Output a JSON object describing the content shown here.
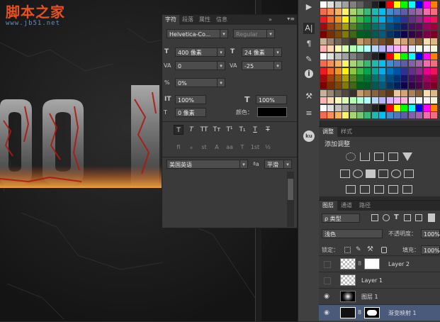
{
  "watermark": {
    "cn": "脚本之家",
    "url": "www.jb51.net"
  },
  "canvas_text": "ool",
  "character_panel": {
    "tabs": [
      "字符",
      "段落",
      "属性",
      "信息"
    ],
    "menu_glyphs": {
      "collapse": "»",
      "menu": "▾≡"
    },
    "font_family": "Helvetica-Co...",
    "font_style": "Regular",
    "font_size": "400 像素",
    "leading": "24 像素",
    "kerning": "0",
    "tracking": "-25",
    "scale_pct": "0%",
    "vertical_scale": "100%",
    "horizontal_scale": "100%",
    "baseline_shift": "0 像素",
    "color_label": "颜色：",
    "color_value": "#000000",
    "style_buttons": [
      "T",
      "T",
      "TT",
      "Tт",
      "T¹",
      "T₁",
      "T",
      "T"
    ],
    "opentype_buttons": [
      "fi",
      "ℴ",
      "st",
      "A",
      "aa",
      "T",
      "1st",
      "½"
    ],
    "language": "美国英语",
    "aa_label": "ªa",
    "antialias": "平滑",
    "ui_glyphs": {
      "T": "T",
      "IT": "IT",
      "VA": "VA",
      "percent": "%",
      "dropdown": "▾"
    }
  },
  "icon_column": {
    "icons": [
      "play-icon",
      "type-icon",
      "paragraph-icon",
      "brush-icon",
      "info-icon",
      "tools-icon",
      "sliders-icon",
      "cc-icon"
    ],
    "glyphs": [
      "▶",
      "A|",
      "¶",
      "✎",
      "i",
      "⚒",
      "≡",
      "ku"
    ]
  },
  "swatch_colors": [
    "#ffffff",
    "#e0e0e0",
    "#c0c0c0",
    "#a0a0a0",
    "#808080",
    "#606060",
    "#404040",
    "#202020",
    "#000000",
    "#ff0000",
    "#ffff00",
    "#00ff00",
    "#00ffff",
    "#0000ff",
    "#ff00ff",
    "#ff8000",
    "#f26c4f",
    "#f68e56",
    "#fbaf5c",
    "#fff467",
    "#acd372",
    "#7cc576",
    "#3bb878",
    "#1abbb4",
    "#00bff3",
    "#438ccb",
    "#5574b9",
    "#605ca8",
    "#855fa8",
    "#a763a9",
    "#f06ea9",
    "#f26d7d",
    "#ed1c24",
    "#f26522",
    "#f7941d",
    "#fff200",
    "#8dc73f",
    "#39b54a",
    "#00a651",
    "#00a99d",
    "#00aeef",
    "#0072bc",
    "#0054a6",
    "#2e3192",
    "#662d91",
    "#92278f",
    "#ec008c",
    "#ed145b",
    "#9e0b0f",
    "#a0410d",
    "#a3620a",
    "#aba000",
    "#598527",
    "#1a7b30",
    "#007236",
    "#00746b",
    "#0076a3",
    "#004b80",
    "#003471",
    "#1b1464",
    "#440e62",
    "#630460",
    "#9e005d",
    "#9e0039",
    "#790000",
    "#7b2e00",
    "#7d4900",
    "#827b00",
    "#406618",
    "#005e20",
    "#005826",
    "#005952",
    "#005b7f",
    "#003663",
    "#002157",
    "#0d004c",
    "#32004b",
    "#4b0049",
    "#7b0046",
    "#7a0026",
    "#c7b299",
    "#998675",
    "#736357",
    "#534741",
    "#37302d",
    "#c69c6d",
    "#a67c52",
    "#8c6239",
    "#754c24",
    "#603913",
    "#e6c8a0",
    "#d4a574",
    "#b08050",
    "#8a5a30",
    "#f5deb3",
    "#deb887",
    "#ffb3b3",
    "#ffd9b3",
    "#ffffb3",
    "#d9ffb3",
    "#b3ffb3",
    "#b3ffd9",
    "#b3ffff",
    "#b3d9ff",
    "#b3b3ff",
    "#d9b3ff",
    "#ffb3ff",
    "#ffb3d9",
    "#e6e6fa",
    "#f0fff0",
    "#fff0f5",
    "#f5f5dc"
  ],
  "adjustments": {
    "tabs": [
      "调整",
      "样式"
    ],
    "title": "添加调整"
  },
  "layers": {
    "tabs": [
      "图层",
      "通道",
      "路径"
    ],
    "filter_label": "ρ 类型",
    "blend_mode": "浅色",
    "opacity_label": "不透明度：",
    "opacity_value": "100%",
    "lock_label": "锁定：",
    "fill_label": "填充：",
    "fill_value": "100%",
    "rows": [
      {
        "name": "Layer 2",
        "visible": false
      },
      {
        "name": "Layer 1",
        "visible": false
      },
      {
        "name": "图层 1",
        "visible": true
      },
      {
        "name": "渐变映射 1",
        "visible": true
      }
    ]
  }
}
